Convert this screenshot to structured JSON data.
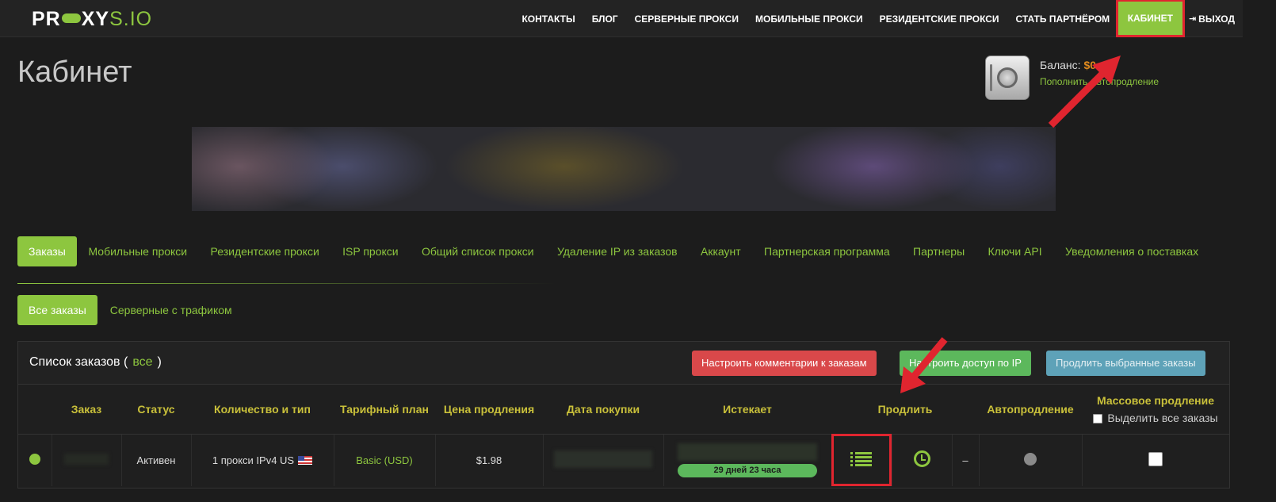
{
  "logo": {
    "left": "PR",
    "right": "XYS.IO",
    "suffix": "S.IO"
  },
  "nav": {
    "links": [
      "КОНТАКТЫ",
      "БЛОГ",
      "СЕРВЕРНЫЕ ПРОКСИ",
      "МОБИЛЬНЫЕ ПРОКСИ",
      "РЕЗИДЕНТСКИЕ ПРОКСИ",
      "СТАТЬ ПАРТНЁРОМ"
    ],
    "active": "КАБИНЕТ",
    "logout": "ВЫХОД"
  },
  "page_title": "Кабинет",
  "balance": {
    "label": "Баланс:",
    "value": "$0",
    "topup": "Пополнить",
    "autorenew": "Автопродление"
  },
  "tabs": [
    "Заказы",
    "Мобильные прокси",
    "Резидентские прокси",
    "ISP прокси",
    "Общий список прокси",
    "Удаление IP из заказов",
    "Аккаунт",
    "Партнерская программа",
    "Партнеры",
    "Ключи API",
    "Уведомления о поставках"
  ],
  "subtabs": [
    "Все заказы",
    "Серверные с трафиком"
  ],
  "orders": {
    "title": "Список заказов (",
    "title_all": "все",
    "title_close": ")",
    "buttons": {
      "comments": "Настроить комментарии к заказам",
      "ip_access": "Настроить доступ по IP",
      "renew_selected": "Продлить выбранные заказы"
    },
    "columns": {
      "order": "Заказ",
      "status": "Статус",
      "qty_type": "Количество и тип",
      "plan": "Тарифный план",
      "renew_price": "Цена продления",
      "purchase_date": "Дата покупки",
      "expires": "Истекает",
      "renew": "Продлить",
      "autorenew": "Автопродление",
      "mass_renew": "Массовое продление",
      "select_all": "Выделить все заказы"
    },
    "row": {
      "status": "Активен",
      "qty_type": "1 прокси IPv4 US",
      "plan": "Basic (USD)",
      "renew_price": "$1.98",
      "expires_badge": "29 дней 23 часа",
      "dash": "–"
    }
  },
  "colors": {
    "accent": "#8dc63f",
    "annotation": "#e0252f",
    "header_text": "#c9c03a"
  }
}
